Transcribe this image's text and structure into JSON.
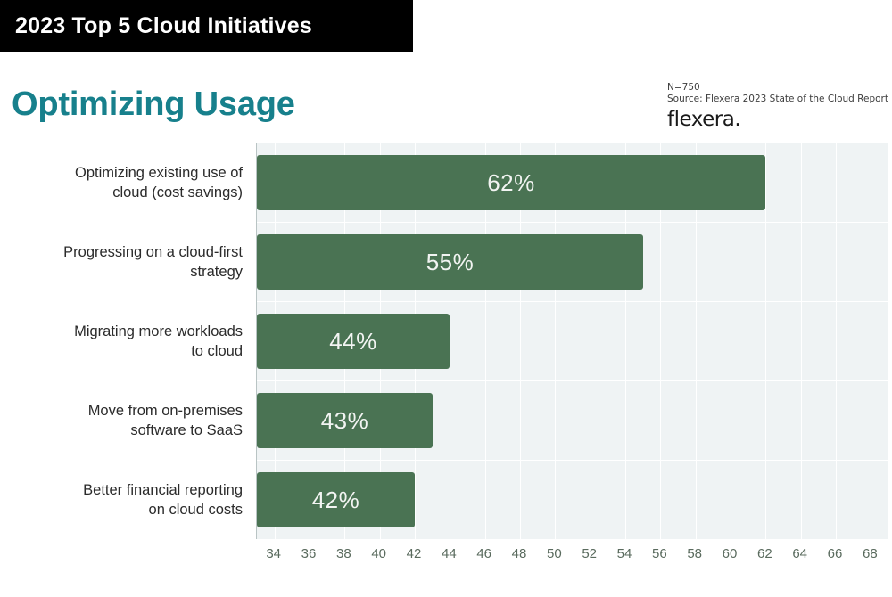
{
  "header": {
    "title": "2023 Top 5 Cloud Initiatives"
  },
  "slide": {
    "title": "Optimizing Usage"
  },
  "source": {
    "sample_size": "N=750",
    "citation": "Source: Flexera 2023 State of the Cloud Report",
    "logo": "flexera."
  },
  "colors": {
    "header_bg": "#000000",
    "title_teal": "#17808c",
    "bar_green": "#4a7353",
    "plot_bg": "#eff3f4",
    "tick_text": "#5a6b5e"
  },
  "chart_data": {
    "type": "bar",
    "orientation": "horizontal",
    "title": "Optimizing Usage",
    "xlabel": "",
    "ylabel": "",
    "xlim": [
      33,
      69
    ],
    "grid": true,
    "legend": false,
    "categories": [
      "Optimizing existing use of cloud (cost savings)",
      "Progressing on a cloud-first strategy",
      "Migrating more workloads to cloud",
      "Move from on-premises software to SaaS",
      "Better financial reporting on cloud costs"
    ],
    "category_lines": [
      [
        "Optimizing existing use of",
        "cloud (cost savings)"
      ],
      [
        "Progressing on a cloud-first",
        "strategy"
      ],
      [
        "Migrating more workloads",
        "to cloud"
      ],
      [
        "Move from on-premises",
        "software to SaaS"
      ],
      [
        "Better financial reporting",
        "on cloud costs"
      ]
    ],
    "values": [
      62,
      55,
      44,
      43,
      42
    ],
    "value_labels": [
      "62%",
      "55%",
      "44%",
      "43%",
      "42%"
    ],
    "tick_values": [
      34,
      36,
      38,
      40,
      42,
      44,
      46,
      48,
      50,
      52,
      54,
      56,
      58,
      60,
      62,
      64,
      66,
      68
    ],
    "tick_labels": [
      "34",
      "36",
      "38",
      "40",
      "42",
      "44",
      "46",
      "48",
      "50",
      "52",
      "54",
      "56",
      "58",
      "60",
      "62",
      "64",
      "66",
      "68"
    ]
  }
}
